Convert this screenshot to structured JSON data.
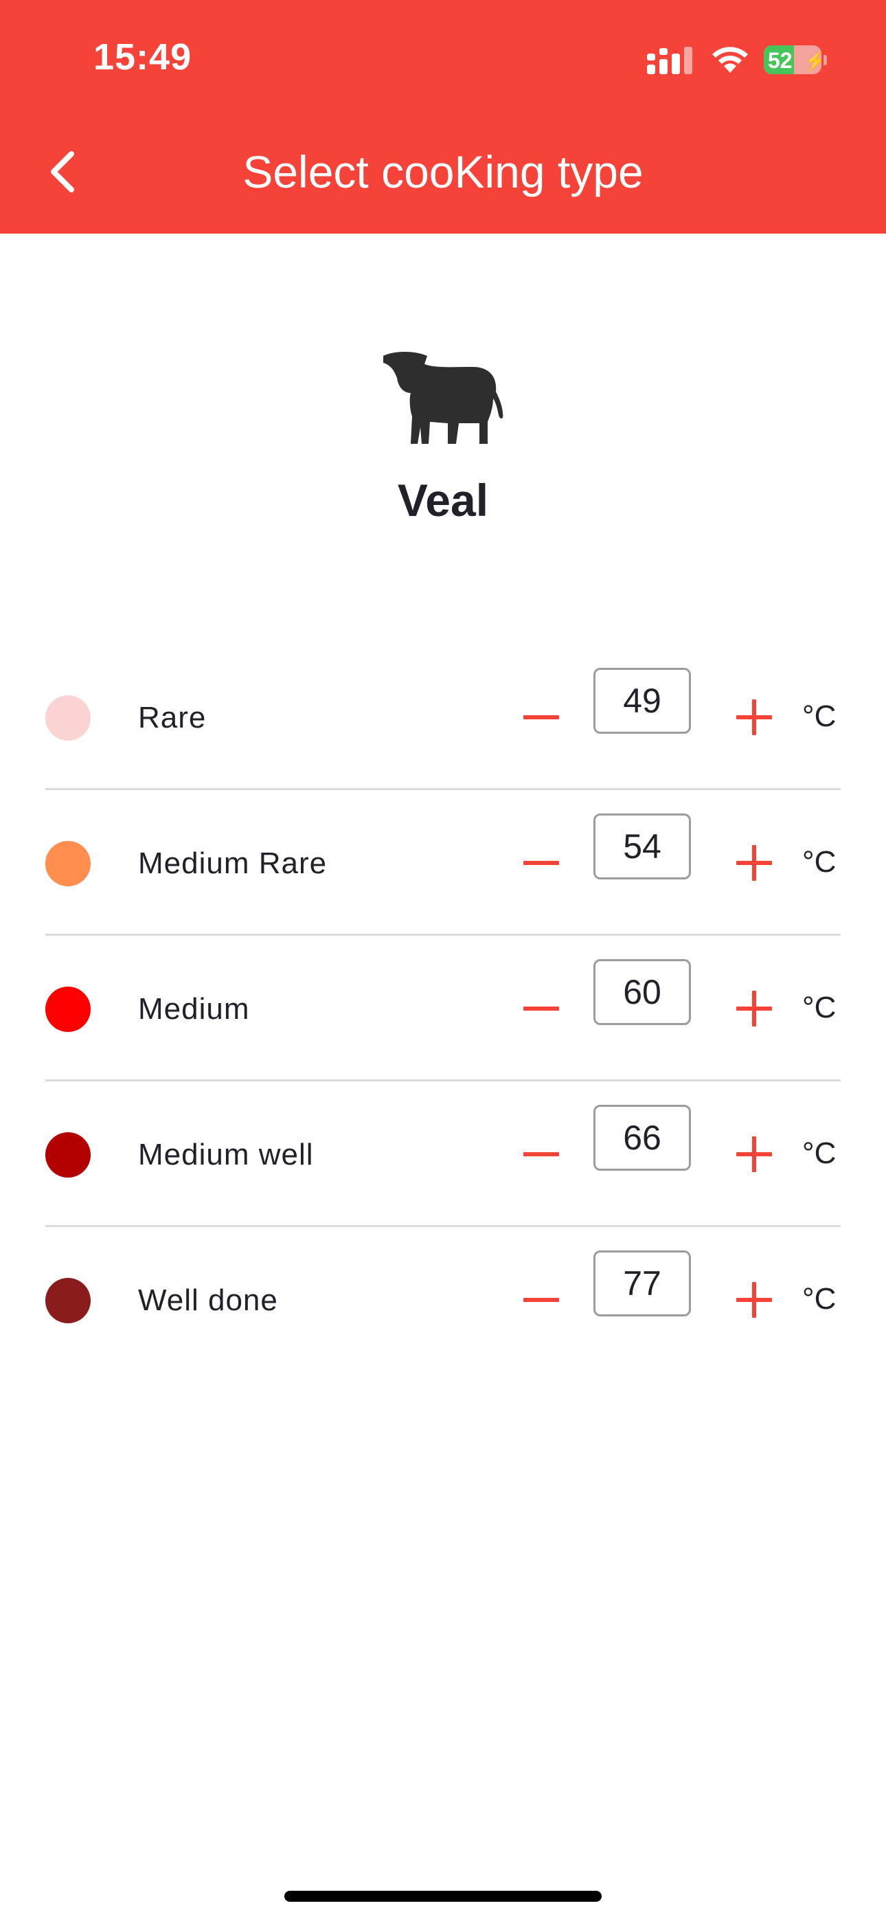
{
  "status_bar": {
    "time": "15:49",
    "battery": "52",
    "battery_level": 0.52
  },
  "header": {
    "title": "Select cooKing type"
  },
  "animal": {
    "name": "Veal",
    "icon": "cow-icon"
  },
  "unit": "°C",
  "levels": [
    {
      "label": "Rare",
      "value": "49",
      "color": "#fcd3d3"
    },
    {
      "label": "Medium Rare",
      "value": "54",
      "color": "#ff8e4e"
    },
    {
      "label": "Medium",
      "value": "60",
      "color": "#ff0000"
    },
    {
      "label": "Medium well",
      "value": "66",
      "color": "#b30000"
    },
    {
      "label": "Well done",
      "value": "77",
      "color": "#8b1c1c"
    }
  ],
  "accent_color": "#f5433a"
}
